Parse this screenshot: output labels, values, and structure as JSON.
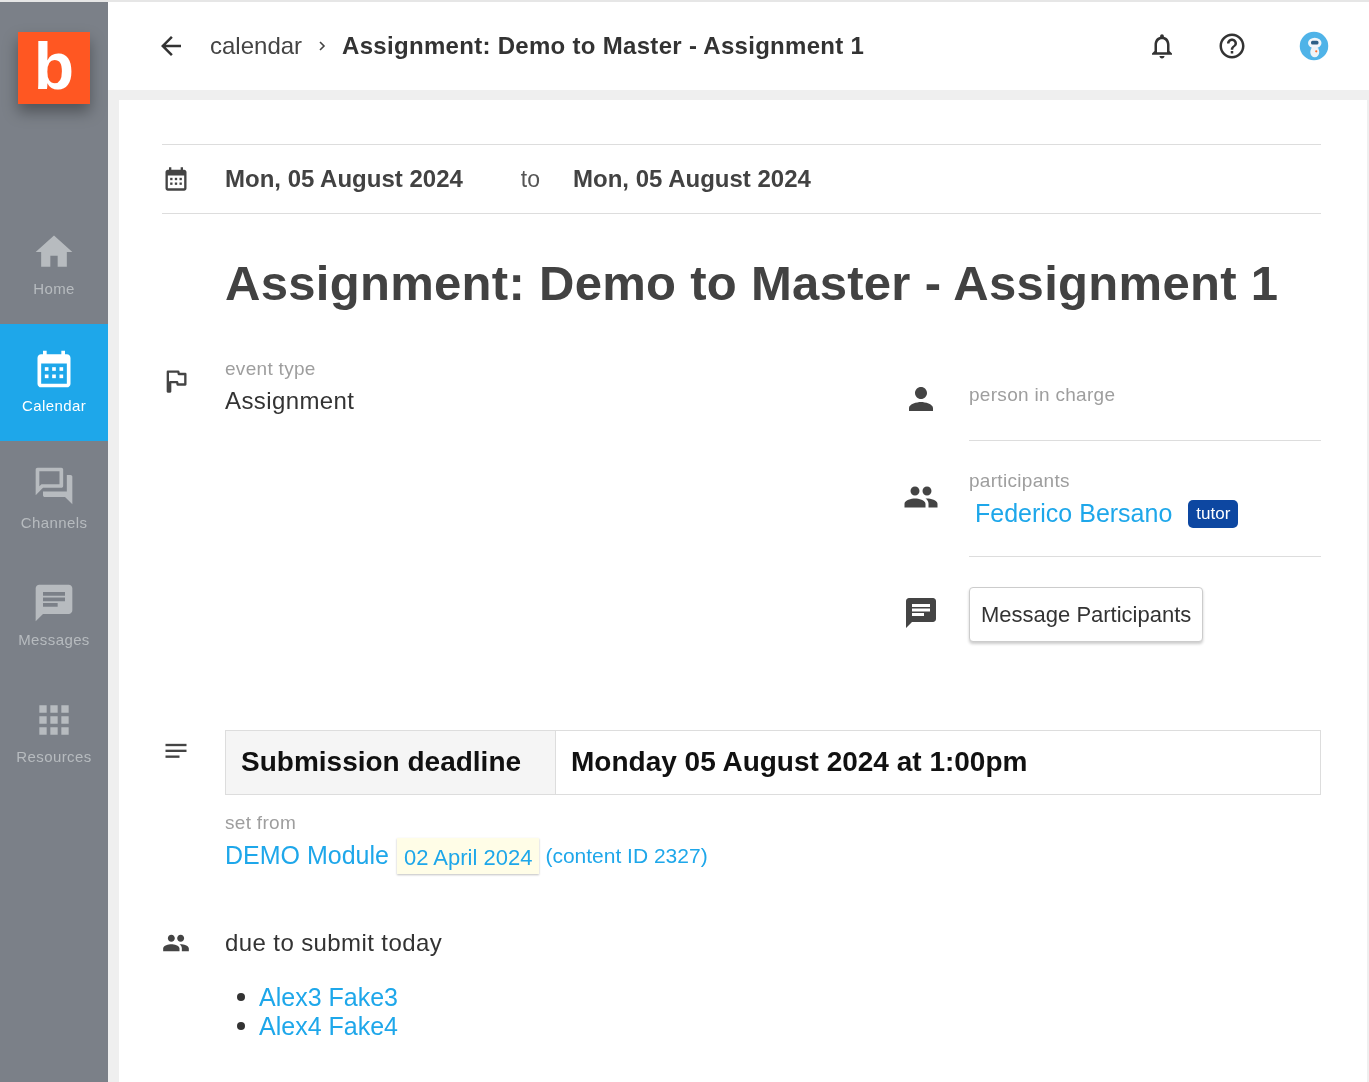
{
  "sidebar": {
    "logo": "b",
    "items": [
      {
        "label": "Home",
        "selected": false
      },
      {
        "label": "Calendar",
        "selected": true
      },
      {
        "label": "Channels",
        "selected": false
      },
      {
        "label": "Messages",
        "selected": false
      },
      {
        "label": "Resources",
        "selected": false
      }
    ]
  },
  "header": {
    "breadcrumb_parent": "calendar",
    "breadcrumb_current": "Assignment: Demo to Master - Assignment 1"
  },
  "dates": {
    "start": "Mon, 05 August 2024",
    "joiner": "to",
    "end": "Mon, 05 August 2024"
  },
  "title": "Assignment: Demo to Master - Assignment 1",
  "event_type": {
    "label": "event type",
    "value": "Assignment"
  },
  "person_in_charge": {
    "label": "person in charge"
  },
  "participants": {
    "label": "participants",
    "people": [
      {
        "name": "Federico Bersano",
        "role": "tutor"
      }
    ]
  },
  "message_button": "Message Participants",
  "deadline": {
    "label": "Submission deadline",
    "value": "Monday 05 August 2024 at 1:00pm"
  },
  "set_from": {
    "label": "set from",
    "module": "DEMO Module",
    "date": "02 April 2024",
    "content_id": "(content ID 2327)"
  },
  "due": {
    "label": "due to submit today",
    "students": [
      "Alex3 Fake3",
      "Alex4 Fake4"
    ]
  }
}
